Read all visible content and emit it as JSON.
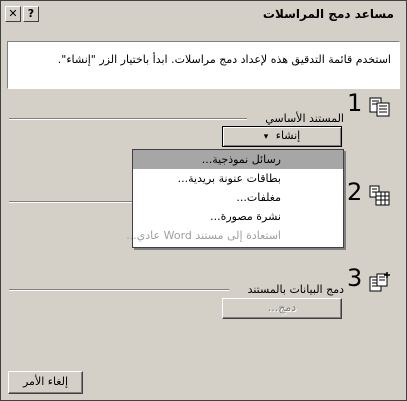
{
  "window": {
    "title": "مساعد دمج المراسلات",
    "help_glyph": "?",
    "close_glyph": "✕"
  },
  "info": {
    "text": "استخدم قائمة التدقيق هذه لإعداد دمج مراسلات. ابدأ باختيار الزر \"إنشاء\"."
  },
  "steps": [
    {
      "number": "1",
      "label": "المستند الأساسي",
      "icon": "main-document-icon"
    },
    {
      "number": "2",
      "label": "",
      "icon": "data-source-icon"
    },
    {
      "number": "3",
      "label": "دمج البيانات بالمستند",
      "icon": "merge-icon"
    }
  ],
  "create_button": {
    "label": "إنشاء",
    "arrow": "▾"
  },
  "create_menu": {
    "items": [
      {
        "label": "رسائل نموذجية...",
        "enabled": true,
        "highlighted": true
      },
      {
        "label": "بطاقات عنونة بريدية...",
        "enabled": true,
        "highlighted": false
      },
      {
        "label": "مغلفات...",
        "enabled": true,
        "highlighted": false
      },
      {
        "label": "نشرة مصورة...",
        "enabled": true,
        "highlighted": false
      },
      {
        "label": "استعادة إلى مستند Word عادي...",
        "enabled": false,
        "highlighted": false
      }
    ]
  },
  "merge_button": {
    "label": "دمج...",
    "enabled": false
  },
  "cancel_button": {
    "label": "إلغاء الأمر"
  }
}
